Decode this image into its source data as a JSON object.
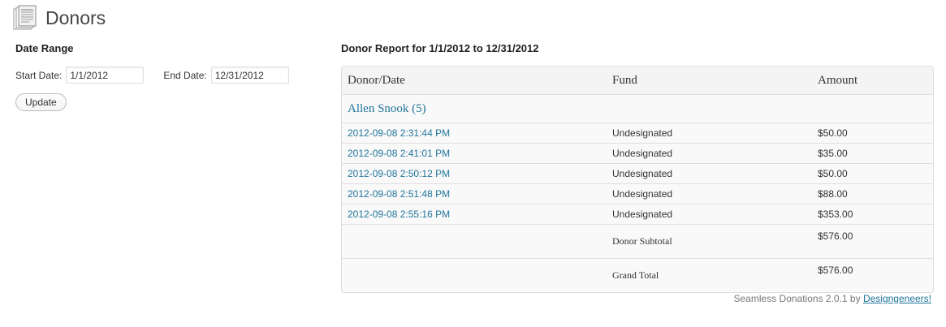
{
  "page": {
    "title": "Donors"
  },
  "date_range": {
    "heading": "Date Range",
    "start_label": "Start Date:",
    "start_value": "1/1/2012",
    "end_label": "End Date:",
    "end_value": "12/31/2012",
    "update_label": "Update"
  },
  "report": {
    "heading": "Donor Report for 1/1/2012 to 12/31/2012",
    "columns": [
      "Donor/Date",
      "Fund",
      "Amount"
    ],
    "donor": {
      "name": "Allen Snook (5)",
      "donations": [
        {
          "date": "2012-09-08 2:31:44 PM",
          "fund": "Undesignated",
          "amount": "$50.00"
        },
        {
          "date": "2012-09-08 2:41:01 PM",
          "fund": "Undesignated",
          "amount": "$35.00"
        },
        {
          "date": "2012-09-08 2:50:12 PM",
          "fund": "Undesignated",
          "amount": "$50.00"
        },
        {
          "date": "2012-09-08 2:51:48 PM",
          "fund": "Undesignated",
          "amount": "$88.00"
        },
        {
          "date": "2012-09-08 2:55:16 PM",
          "fund": "Undesignated",
          "amount": "$353.00"
        }
      ],
      "subtotal_label": "Donor Subtotal",
      "subtotal_amount": "$576.00"
    },
    "grand_total_label": "Grand Total",
    "grand_total_amount": "$576.00"
  },
  "footer": {
    "text": "Seamless Donations 2.0.1 by ",
    "link": "Designgeneers!"
  },
  "colors": {
    "link": "#21759b",
    "border": "#dfdfdf",
    "table_bg": "#f9f9f9"
  },
  "icons": {
    "page_icon": "document-stack-icon"
  }
}
